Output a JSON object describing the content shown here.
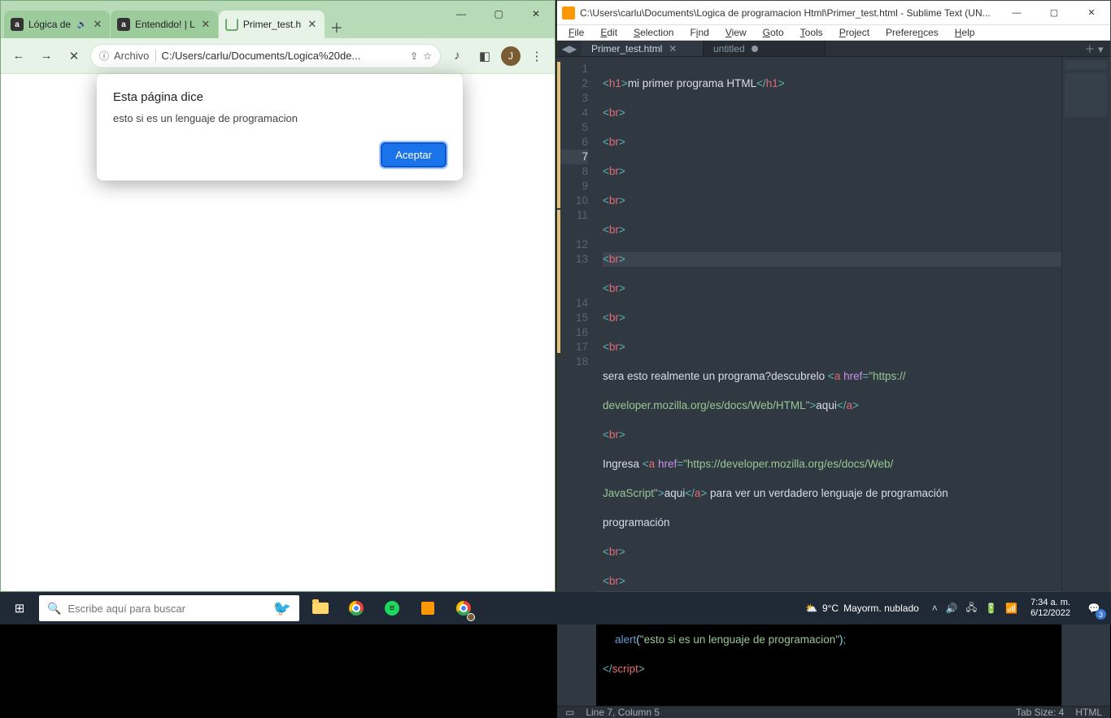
{
  "chrome": {
    "tabs": [
      {
        "title": "Lógica de",
        "favicon": "a",
        "audio": true
      },
      {
        "title": "Entendido! | L",
        "favicon": "a",
        "audio": false
      },
      {
        "title": "Primer_test.h",
        "favicon": "spin",
        "audio": false,
        "active": true
      }
    ],
    "url_prefix": "Archivo",
    "url": "C:/Users/carlu/Documents/Logica%20de...",
    "avatar_letter": "J",
    "dialog": {
      "title": "Esta página dice",
      "message": "esto si es un lenguaje de programacion",
      "accept": "Aceptar"
    }
  },
  "sublime": {
    "title": "C:\\Users\\carlu\\Documents\\Logica de programacion Html\\Primer_test.html - Sublime Text (UN...",
    "menu": [
      "File",
      "Edit",
      "Selection",
      "Find",
      "View",
      "Goto",
      "Tools",
      "Project",
      "Preferences",
      "Help"
    ],
    "tabs": [
      {
        "name": "Primer_test.html",
        "active": true,
        "dirty": false
      },
      {
        "name": "untitled",
        "active": false,
        "dirty": true
      }
    ],
    "lines": [
      "1",
      "2",
      "3",
      "4",
      "5",
      "6",
      "7",
      "8",
      "9",
      "10",
      "11",
      "",
      "12",
      "13",
      "",
      "",
      "14",
      "15",
      "16",
      "17",
      "18"
    ],
    "highlight_line_index": 6,
    "code": {
      "h1_text": "mi primer programa HTML",
      "line11a": "sera esto realmente un programa?descubrelo ",
      "href1": "https://developer.mozilla.org/es/docs/Web/HTML",
      "link1_text": "aqui",
      "line13a": "Ingresa ",
      "href2": "https://developer.mozilla.org/es/docs/Web/JavaScript",
      "link2_text": "aqui",
      "line13b": " para ver un verdadero lenguaje de programación",
      "alert_str": "\"esto si es un lenguaje de programacion\""
    },
    "status": {
      "pos": "Line 7, Column 5",
      "tabsize": "Tab Size: 4",
      "syntax": "HTML"
    }
  },
  "taskbar": {
    "search_placeholder": "Escribe aquí para buscar",
    "weather_temp": "9°C",
    "weather_text": "Mayorm. nublado",
    "time": "7:34 a. m.",
    "date": "6/12/2022",
    "notif_count": "3"
  }
}
